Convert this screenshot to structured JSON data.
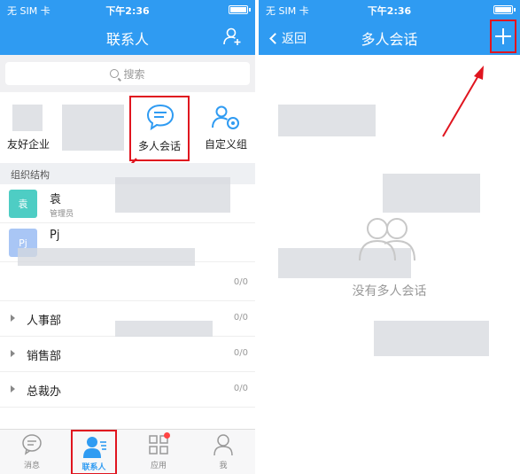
{
  "status": {
    "carrier": "无 SIM 卡",
    "time": "下午2:36"
  },
  "left": {
    "title": "联系人",
    "search": {
      "placeholder": "搜索"
    },
    "quick": [
      {
        "label": "友好企业"
      },
      {
        "label": "多人会话"
      },
      {
        "label": "自定义组"
      }
    ],
    "section_header": "组织结构",
    "people": [
      {
        "name": "袁",
        "role": "管理员",
        "avatar": "袁"
      },
      {
        "name": "Pj",
        "role": "",
        "avatar": "Pj"
      }
    ],
    "departments": [
      {
        "name": "",
        "count": "0/0"
      },
      {
        "name": "人事部",
        "count": "0/0"
      },
      {
        "name": "销售部",
        "count": "0/0"
      },
      {
        "name": "总裁办",
        "count": "0/0"
      }
    ],
    "tabs": [
      {
        "label": "消息"
      },
      {
        "label": "联系人"
      },
      {
        "label": "应用"
      },
      {
        "label": "我"
      }
    ]
  },
  "right": {
    "back_label": "返回",
    "title": "多人会话",
    "empty_text": "没有多人会话"
  },
  "colors": {
    "accent": "#2f9bf2",
    "highlight": "#e0151f"
  }
}
